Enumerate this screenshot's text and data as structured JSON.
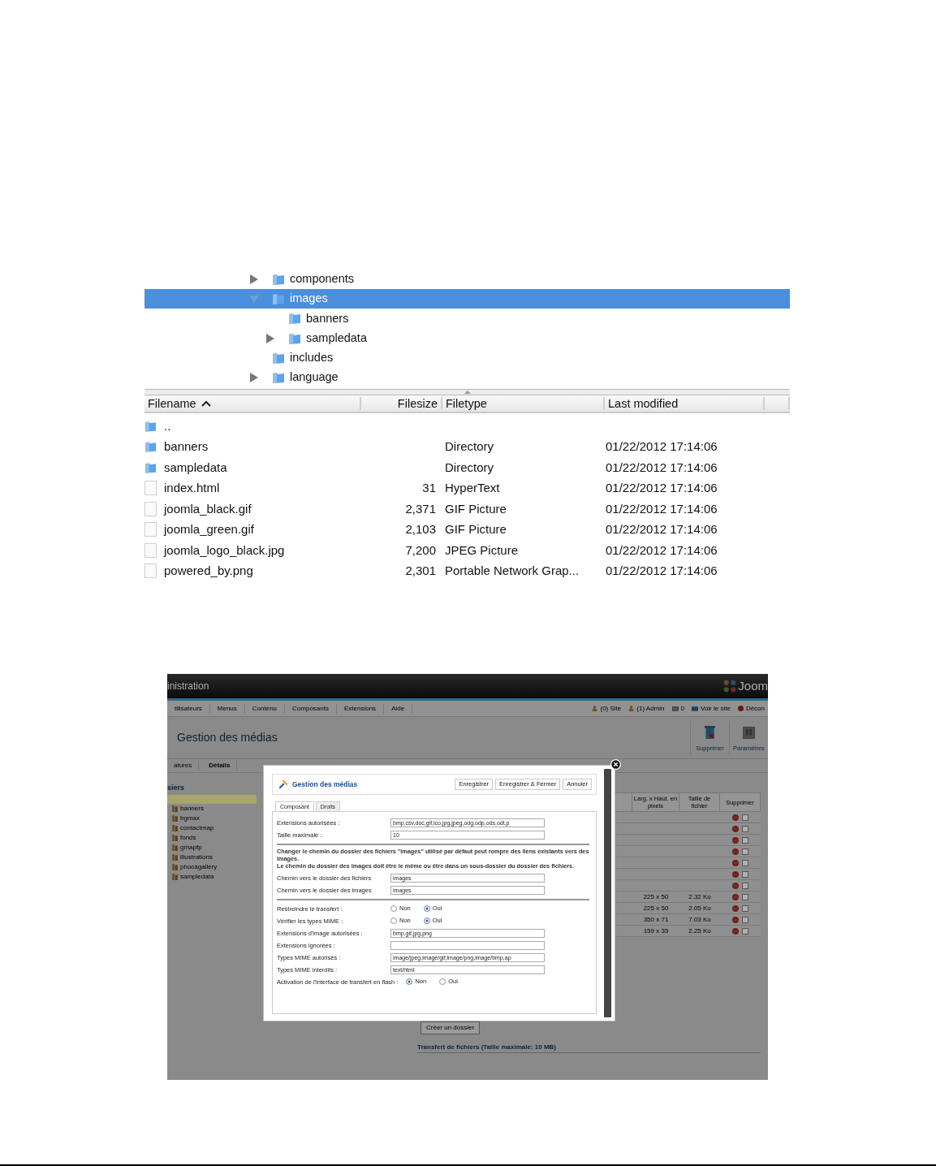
{
  "file_browser": {
    "tree": [
      {
        "name": "components",
        "selected": false,
        "expanded": false
      },
      {
        "name": "images",
        "selected": true,
        "expanded": true,
        "children": [
          {
            "name": "banners",
            "selected": false
          },
          {
            "name": "sampledata",
            "selected": false,
            "expanded": false
          }
        ]
      },
      {
        "name": "includes",
        "selected": false
      },
      {
        "name": "language",
        "selected": false,
        "expanded": false
      }
    ],
    "columns": [
      {
        "label": "Filename",
        "sorted": true
      },
      {
        "label": "Filesize",
        "sorted": false
      },
      {
        "label": "Filetype",
        "sorted": false
      },
      {
        "label": "Last modified",
        "sorted": false
      }
    ],
    "files": [
      {
        "kind": "folder",
        "name": ".."
      },
      {
        "kind": "folder",
        "name": "banners",
        "type": "Directory",
        "modified": "01/22/2012 17:14:06"
      },
      {
        "kind": "folder",
        "name": "sampledata",
        "type": "Directory",
        "modified": "01/22/2012 17:14:06"
      },
      {
        "kind": "file",
        "name": "index.html",
        "size": "31",
        "type": "HyperText",
        "modified": "01/22/2012 17:14:06"
      },
      {
        "kind": "file",
        "name": "joomla_black.gif",
        "size": "2,371",
        "type": "GIF Picture",
        "modified": "01/22/2012 17:14:06"
      },
      {
        "kind": "file",
        "name": "joomla_green.gif",
        "size": "2,103",
        "type": "GIF Picture",
        "modified": "01/22/2012 17:14:06"
      },
      {
        "kind": "file",
        "name": "joomla_logo_black.jpg",
        "size": "7,200",
        "type": "JPEG Picture",
        "modified": "01/22/2012 17:14:06"
      },
      {
        "kind": "file",
        "name": "powered_by.png",
        "size": "2,301",
        "type": "Portable Network Grap...",
        "modified": "01/22/2012 17:14:06"
      }
    ]
  },
  "admin_screenshot": {
    "header_title": "inistration",
    "logo_text": "Joom",
    "menu": [
      "tilisateurs",
      "Menus",
      "Contenu",
      "Composants",
      "Extensions",
      "Aide"
    ],
    "status_links": [
      {
        "kind": "user",
        "label": "(0) Site"
      },
      {
        "kind": "user",
        "label": "(1) Admin"
      },
      {
        "kind": "mail",
        "label": "0"
      },
      {
        "kind": "screen",
        "label": "Voir le site"
      },
      {
        "kind": "power",
        "label": "Décon"
      }
    ],
    "page_title": "Gestion des médias",
    "toolbar": [
      {
        "kind": "trash",
        "label": "Supprimer"
      },
      {
        "kind": "options",
        "label": "Paramètres"
      }
    ],
    "view_tabs": [
      {
        "label": "atures",
        "selected": false
      },
      {
        "label": "Détails",
        "selected": true
      }
    ],
    "folders_heading": "siers",
    "folders": [
      "banners",
      "bgmax",
      "contactmap",
      "fonds",
      "gmapfp",
      "illustrations",
      "phocagallery",
      "sampledata"
    ],
    "table_columns": [
      "Larg. x Haut. en pixels",
      "Taille de fichier",
      "Supprimer"
    ],
    "table_rows": [
      {
        "checked": false
      },
      {
        "checked": false
      },
      {
        "checked": false
      },
      {
        "checked": false
      },
      {
        "checked": false
      },
      {
        "checked": false
      },
      {
        "checked": false
      },
      {
        "checked": false,
        "dimensions": "225 x 50",
        "filesize": "2.32 Ko"
      },
      {
        "checked": false,
        "dimensions": "225 x 50",
        "filesize": "2.05 Ko"
      },
      {
        "checked": false,
        "dimensions": "350 x 71",
        "filesize": "7.03 Ko"
      },
      {
        "checked": false,
        "dimensions": "159 x 35",
        "filesize": "2.25 Ko"
      }
    ],
    "create_folder": "Créer un dossier",
    "upload_legend": "Transfert de fichiers (Taille maximale: 10 MB)",
    "modal": {
      "title": "Gestion des médias",
      "buttons": [
        "Enregistrer",
        "Enregistrer & Fermer",
        "Annuler"
      ],
      "tabs": [
        {
          "label": "Composant",
          "selected": true
        },
        {
          "label": "Droits",
          "selected": false
        }
      ],
      "form": [
        {
          "kind": "text",
          "label": "Extensions autorisées :",
          "value": "bmp,csv,doc,gif,ico,jpg,jpeg,odg,odp,ods,odt,p"
        },
        {
          "kind": "text",
          "label": "Taille maximale :",
          "value": "10"
        },
        {
          "kind": "divider"
        },
        {
          "kind": "note",
          "lines": [
            "Changer le chemin du dossier des fichiers \"images\" utilisé par défaut peut rompre des liens existants vers des images.",
            "Le chemin du dossier des images doit être le même ou être dans un sous-dossier du dossier des fichiers."
          ]
        },
        {
          "kind": "text",
          "label": "Chemin vers le dossier des fichiers",
          "value": "images"
        },
        {
          "kind": "text",
          "label": "Chemin vers le dossier des images",
          "value": "images"
        },
        {
          "kind": "divider"
        },
        {
          "kind": "radio",
          "label": "Restreindre le transfert :",
          "options": [
            {
              "label": "Non",
              "selected": false
            },
            {
              "label": "Oui",
              "selected": true
            }
          ]
        },
        {
          "kind": "radio",
          "label": "Vérifier les types MIME :",
          "options": [
            {
              "label": "Non",
              "selected": false
            },
            {
              "label": "Oui",
              "selected": true
            }
          ]
        },
        {
          "kind": "text",
          "label": "Extensions d'image autorisées :",
          "value": "bmp,gif,jpg,png"
        },
        {
          "kind": "text",
          "label": "Extensions ignorées :"
        },
        {
          "kind": "text",
          "label": "Types MIME autorisés :",
          "value": "image/jpeg,image/gif,image/png,image/bmp,ap"
        },
        {
          "kind": "text",
          "label": "Types MIME interdits :",
          "value": "text/html"
        },
        {
          "kind": "radio",
          "label": "Activation de l'interface de transfert en flash :",
          "inline": true,
          "options": [
            {
              "label": "Non",
              "selected": true
            },
            {
              "label": "Oui",
              "selected": false
            }
          ]
        }
      ]
    }
  }
}
